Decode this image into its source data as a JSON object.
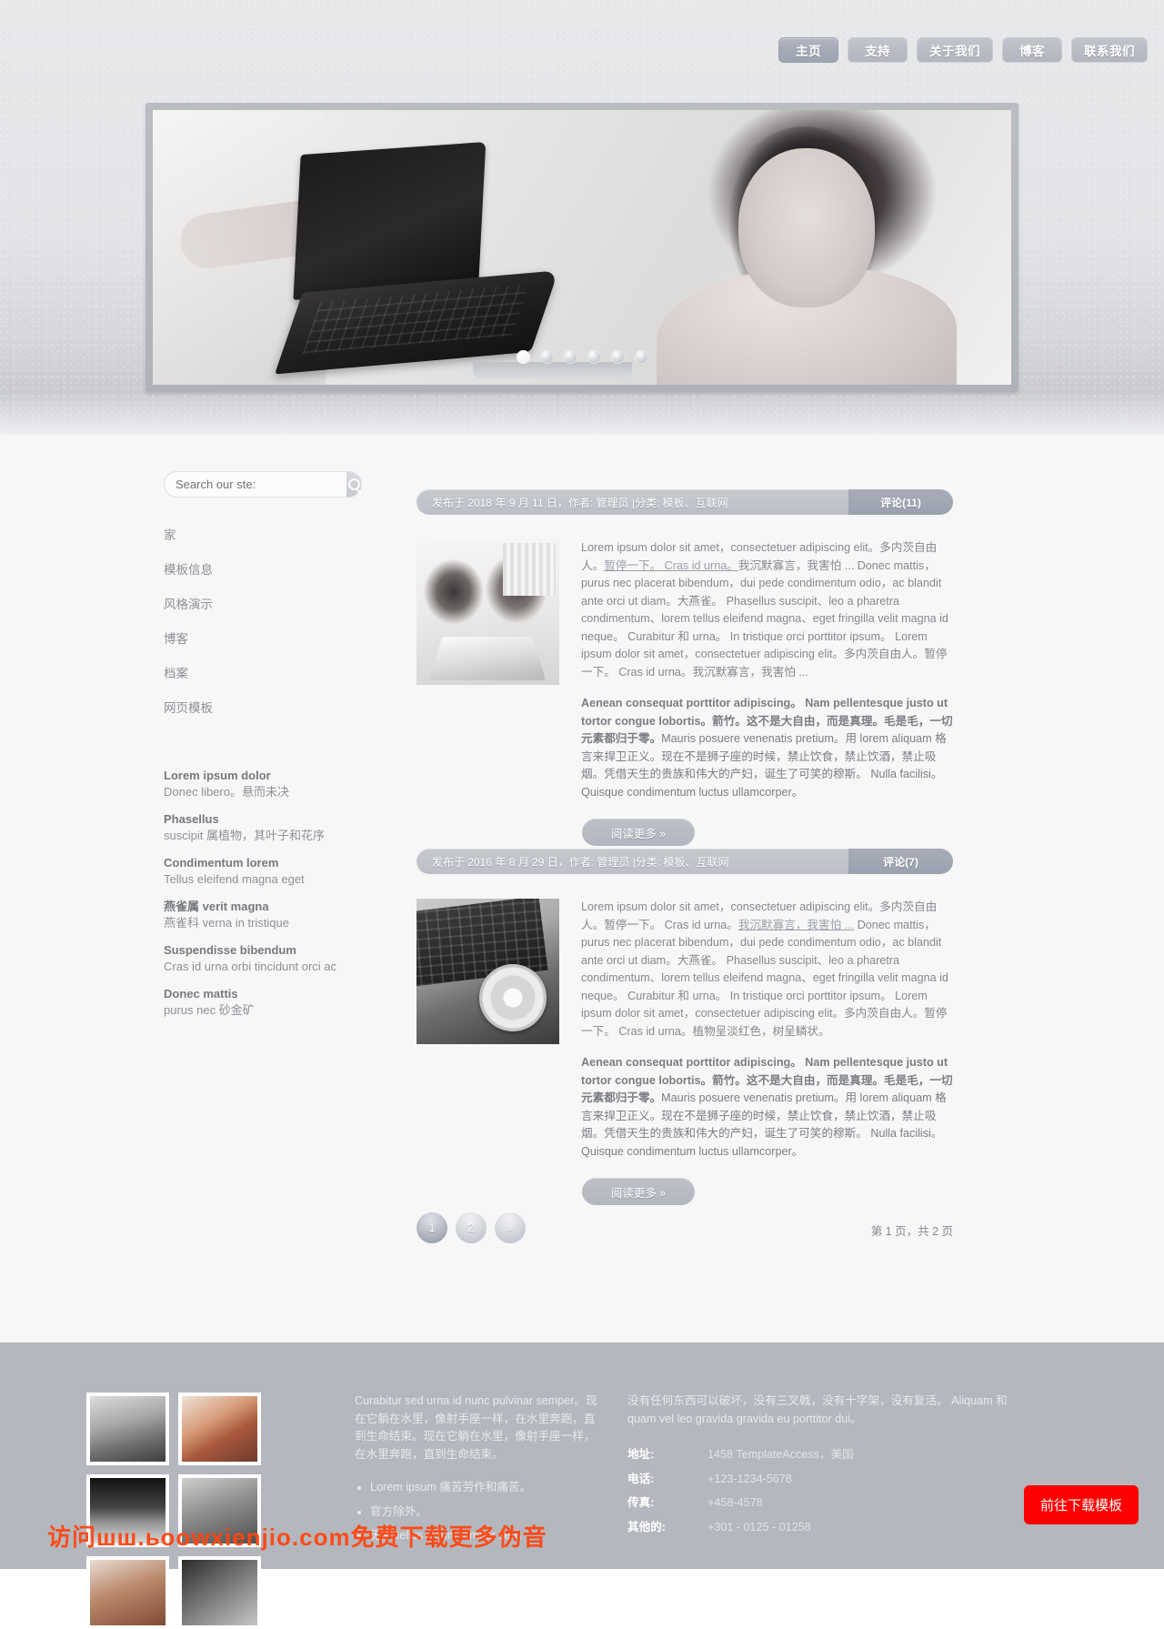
{
  "nav": {
    "items": [
      {
        "label": "主页",
        "active": true
      },
      {
        "label": "支持",
        "active": false
      },
      {
        "label": "关于我们",
        "active": false
      },
      {
        "label": "博客",
        "active": false
      },
      {
        "label": "联系我们",
        "active": false
      }
    ]
  },
  "slider": {
    "dots": 6,
    "active_index": 0
  },
  "search": {
    "placeholder": "Search our ste:",
    "value": "",
    "icon": "search-icon"
  },
  "sidebar": {
    "items": [
      {
        "label": "家"
      },
      {
        "label": "模板信息"
      },
      {
        "label": "风格演示"
      },
      {
        "label": "博客"
      },
      {
        "label": "档案"
      },
      {
        "label": "网页模板"
      }
    ],
    "definitions": [
      {
        "term": "Lorem ipsum dolor",
        "desc": "Donec libero。悬而未决"
      },
      {
        "term": "Phasellus",
        "desc": "suscipit 属植物，其叶子和花序"
      },
      {
        "term": "Condimentum lorem",
        "desc": "Tellus eleifend magna eget"
      },
      {
        "term": "燕雀属 verit magna",
        "desc": "燕雀科 verna in tristique"
      },
      {
        "term": "Suspendisse bibendum",
        "desc": "Cras id urna orbi tincidunt orci ac"
      },
      {
        "term": "Donec mattis",
        "desc": "purus nec 砂金矿"
      }
    ]
  },
  "posts": [
    {
      "meta": "发布于 2018 年 9 月 11 日，作者: 管理员  |分类: 模板、互联网",
      "comments": "评论(11)",
      "body_lead": "Lorem ipsum dolor sit amet，consectetuer adipiscing elit。多内茨自由人。",
      "body_link": "暂停一下。 Cras id urna。",
      "body_rest": "我沉默寡言，我害怕 ... Donec mattis，purus nec placerat bibendum，dui pede condimentum odio，ac blandit ante orci ut diam。大燕雀。 Phasellus suscipit、leo a pharetra condimentum、lorem tellus eleifend magna、eget fringilla velit magna id neque。 Curabitur 和 urna。 In tristique orci porttitor ipsum。 Lorem ipsum dolor sit amet，consectetuer adipiscing elit。多内茨自由人。暂停一下。 Cras id urna。我沉默寡言，我害怕 ...",
      "body_bold": "Aenean consequat porttitor adipiscing。 Nam pellentesque justo ut tortor congue lobortis。箭竹。这不是大自由，而是真理。毛是毛，一切元素都归于零。",
      "body_tail": "Mauris posuere venenatis pretium。用 lorem aliquam 格言来捍卫正义。现在不是狮子座的时候，禁止饮食，禁止饮酒，禁止吸烟。凭借天生的贵族和伟大的产妇，诞生了可笑的穆斯。 Nulla facilisi。 Quisque condimentum luctus ullamcorper。",
      "readmore": "阅读更多 »",
      "thumb": "thumb-two-women-laptop"
    },
    {
      "meta": "发布于 2016 年 8 月 29 日，作者: 管理员  |分类: 模板、互联网",
      "comments": "评论(7)",
      "body_lead": "Lorem ipsum dolor sit amet，consectetuer adipiscing elit。多内茨自由人。暂停一下。 Cras id urna。",
      "body_link": "我沉默寡言，我害怕 ...",
      "body_rest": " Donec mattis，purus nec placerat bibendum，dui pede condimentum odio，ac blandit ante orci ut diam。大燕雀。 Phasellus suscipit、leo a pharetra condimentum、lorem tellus eleifend magna、eget fringilla velit magna id neque。 Curabitur 和 urna。 In tristique orci porttitor ipsum。 Lorem ipsum dolor sit amet，consectetuer adipiscing elit。多内茨自由人。暂停一下。 Cras id urna。植物呈淡红色，树呈鳞状。",
      "body_bold": "Aenean consequat porttitor adipiscing。 Nam pellentesque justo ut tortor congue lobortis。箭竹。这不是大自由，而是真理。毛是毛，一切元素都归于零。",
      "body_tail": "Mauris posuere venenatis pretium。用 lorem aliquam 格言来捍卫正义。现在不是狮子座的时候，禁止饮食，禁止饮酒，禁止吸烟。凭借天生的贵族和伟大的产妇，诞生了可笑的穆斯。 Nulla facilisi。 Quisque condimentum luctus ullamcorper。",
      "readmore": "阅读更多 »",
      "thumb": "thumb-laptop-cd-drive"
    }
  ],
  "pagination": {
    "pages": [
      {
        "label": "1",
        "current": true
      },
      {
        "label": "2",
        "current": false
      },
      {
        "label": "»",
        "current": false
      }
    ],
    "summary": "第 1 页，共 2 页"
  },
  "footer": {
    "gallery": [
      {
        "name": "gallery-thumb-1"
      },
      {
        "name": "gallery-thumb-2"
      },
      {
        "name": "gallery-thumb-3"
      },
      {
        "name": "gallery-thumb-4"
      },
      {
        "name": "gallery-thumb-5"
      },
      {
        "name": "gallery-thumb-6"
      }
    ],
    "text_paragraph": "Curabitur sed urna id nunc pulvinar semper。现在它躺在水里，像射手座一样，在水里奔跑，直到生命结束。现在它躺在水里，像射手座一样，在水里奔跑，直到生命结束。",
    "text_list": [
      "Lorem ipsum 痛苦劳作和痛苦。",
      "官方除外。",
      "无数 tellus ipsum tempor sed。"
    ],
    "contact_paragraph": "没有任何东西可以破坏，没有三叉戟，没有十字架，没有复活。 Aliquam 和 quam vel leo gravida gravida eu porttitor dui。",
    "contact_rows": [
      {
        "label": "地址:",
        "value": "1458 TemplateAccess，美国"
      },
      {
        "label": "电话:",
        "value": "+123-1234-5678"
      },
      {
        "label": "传真:",
        "value": "+458-4578"
      },
      {
        "label": "其他的:",
        "value": "+301 - 0125 - 01258"
      }
    ],
    "download_button": "前往下载模板",
    "watermark": "访问шш.ьoowxienjio.com免费下载更多伪音"
  }
}
